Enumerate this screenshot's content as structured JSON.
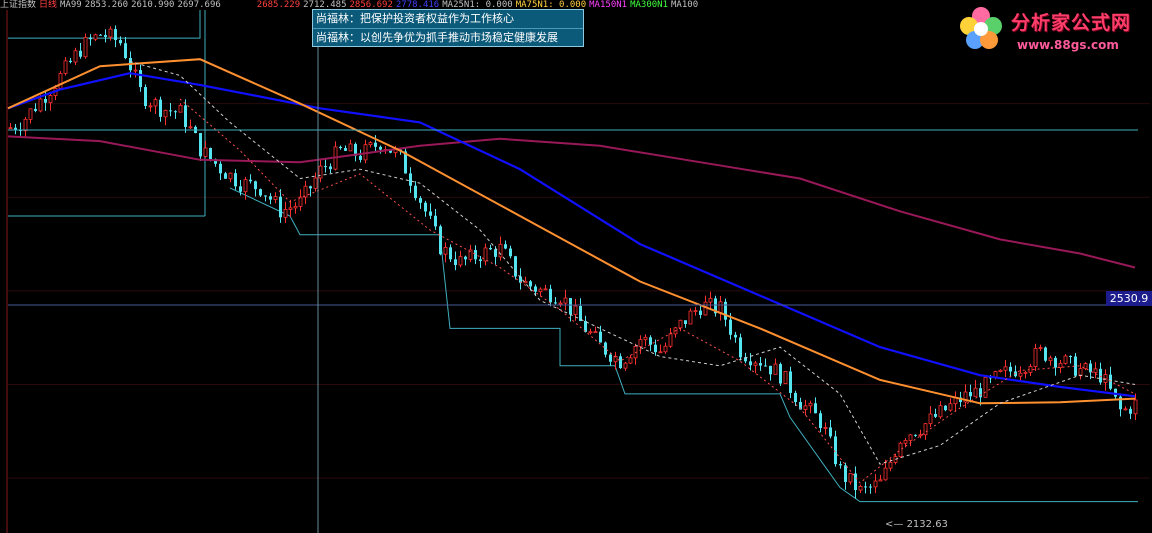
{
  "topbar": {
    "symbol": "上证指数",
    "period": "日线",
    "ma99_label": "MA99",
    "values": [
      "2853.260",
      "2610.990",
      "2697.696"
    ],
    "values2": [
      "2685.229",
      "2712.485",
      "2856.692",
      "2778.416"
    ],
    "ma25_label": "MA25N1: 0.000",
    "ma75_label": "MA75N1: 0.000",
    "ma150_label": "MA150N1",
    "ma300_label": "MA300N1",
    "ma100_label": "MA100"
  },
  "tooltip": {
    "line1": "尚福林：把保护投资者权益作为工作核心",
    "line2": "尚福林：以创先争优为抓手推动市场稳定健康发展"
  },
  "price_tag": "2530.9",
  "low_label": "2132.63",
  "logo": {
    "brand": "分析家公式网",
    "url": "www.88gs.com",
    "icon": "flower-logo-icon"
  },
  "colors": {
    "up": "#ff3030",
    "down": "#55e5f0",
    "ma_blue": "#1010ff",
    "ma_orange": "#ff9030",
    "ma_purple": "#981858",
    "ma_dashed_white": "#d0d0d0",
    "ma_dashed_red": "#ff5050",
    "cyan_line": "#40b0c0"
  },
  "chart_data": {
    "type": "candlestick",
    "price_level_line": 2530.9,
    "low_marker": 2132.63,
    "ylim": [
      2100,
      3200
    ],
    "close_path": [
      [
        0,
        2940
      ],
      [
        20,
        2960
      ],
      [
        40,
        3010
      ],
      [
        60,
        3060
      ],
      [
        80,
        3120
      ],
      [
        100,
        3150
      ],
      [
        120,
        3130
      ],
      [
        140,
        3020
      ],
      [
        160,
        2990
      ],
      [
        180,
        2980
      ],
      [
        200,
        2900
      ],
      [
        220,
        2860
      ],
      [
        240,
        2830
      ],
      [
        260,
        2820
      ],
      [
        280,
        2770
      ],
      [
        300,
        2790
      ],
      [
        320,
        2860
      ],
      [
        340,
        2900
      ],
      [
        360,
        2890
      ],
      [
        380,
        2920
      ],
      [
        400,
        2880
      ],
      [
        420,
        2790
      ],
      [
        440,
        2690
      ],
      [
        460,
        2660
      ],
      [
        480,
        2680
      ],
      [
        500,
        2690
      ],
      [
        520,
        2620
      ],
      [
        540,
        2600
      ],
      [
        560,
        2590
      ],
      [
        580,
        2530
      ],
      [
        600,
        2480
      ],
      [
        620,
        2450
      ],
      [
        640,
        2500
      ],
      [
        660,
        2470
      ],
      [
        680,
        2530
      ],
      [
        700,
        2570
      ],
      [
        720,
        2560
      ],
      [
        740,
        2470
      ],
      [
        760,
        2450
      ],
      [
        780,
        2420
      ],
      [
        800,
        2360
      ],
      [
        820,
        2320
      ],
      [
        840,
        2210
      ],
      [
        860,
        2170
      ],
      [
        880,
        2190
      ],
      [
        900,
        2290
      ],
      [
        920,
        2310
      ],
      [
        940,
        2340
      ],
      [
        960,
        2370
      ],
      [
        980,
        2390
      ],
      [
        1000,
        2420
      ],
      [
        1020,
        2440
      ],
      [
        1040,
        2470
      ],
      [
        1060,
        2450
      ],
      [
        1080,
        2430
      ],
      [
        1100,
        2420
      ],
      [
        1120,
        2340
      ],
      [
        1135,
        2360
      ]
    ],
    "ma_blue": [
      [
        8,
        2990
      ],
      [
        60,
        3030
      ],
      [
        130,
        3065
      ],
      [
        200,
        3040
      ],
      [
        320,
        2990
      ],
      [
        420,
        2960
      ],
      [
        520,
        2860
      ],
      [
        640,
        2700
      ],
      [
        760,
        2590
      ],
      [
        880,
        2480
      ],
      [
        980,
        2420
      ],
      [
        1060,
        2395
      ],
      [
        1135,
        2375
      ]
    ],
    "ma_orange": [
      [
        8,
        2990
      ],
      [
        100,
        3080
      ],
      [
        200,
        3095
      ],
      [
        300,
        3000
      ],
      [
        400,
        2900
      ],
      [
        520,
        2760
      ],
      [
        640,
        2620
      ],
      [
        760,
        2520
      ],
      [
        880,
        2410
      ],
      [
        980,
        2360
      ],
      [
        1060,
        2362
      ],
      [
        1135,
        2370
      ]
    ],
    "ma_purple": [
      [
        8,
        2930
      ],
      [
        100,
        2920
      ],
      [
        200,
        2880
      ],
      [
        300,
        2875
      ],
      [
        420,
        2910
      ],
      [
        500,
        2925
      ],
      [
        600,
        2910
      ],
      [
        700,
        2875
      ],
      [
        800,
        2840
      ],
      [
        900,
        2770
      ],
      [
        1000,
        2710
      ],
      [
        1080,
        2680
      ],
      [
        1135,
        2650
      ]
    ],
    "ma_dashed_white": [
      [
        130,
        3090
      ],
      [
        180,
        3060
      ],
      [
        230,
        2960
      ],
      [
        300,
        2840
      ],
      [
        360,
        2860
      ],
      [
        420,
        2830
      ],
      [
        480,
        2730
      ],
      [
        540,
        2580
      ],
      [
        600,
        2520
      ],
      [
        660,
        2460
      ],
      [
        720,
        2440
      ],
      [
        780,
        2480
      ],
      [
        840,
        2380
      ],
      [
        880,
        2230
      ],
      [
        940,
        2270
      ],
      [
        1000,
        2360
      ],
      [
        1080,
        2420
      ],
      [
        1135,
        2400
      ]
    ],
    "ma_dashed_red": [
      [
        180,
        3010
      ],
      [
        240,
        2900
      ],
      [
        290,
        2790
      ],
      [
        360,
        2850
      ],
      [
        430,
        2730
      ],
      [
        500,
        2650
      ],
      [
        560,
        2560
      ],
      [
        620,
        2450
      ],
      [
        680,
        2520
      ],
      [
        740,
        2450
      ],
      [
        800,
        2350
      ],
      [
        860,
        2190
      ],
      [
        900,
        2260
      ],
      [
        960,
        2350
      ],
      [
        1020,
        2430
      ],
      [
        1080,
        2440
      ],
      [
        1135,
        2380
      ]
    ],
    "cyan_steps": [
      [
        [
          8,
          3140
        ],
        [
          200,
          3140
        ],
        [
          200,
          3200
        ]
      ],
      [
        [
          205,
          3200
        ],
        [
          205,
          2760
        ]
      ],
      [
        [
          8,
          2760
        ],
        [
          205,
          2760
        ]
      ],
      [
        [
          230,
          2820
        ],
        [
          290,
          2760
        ],
        [
          300,
          2720
        ],
        [
          440,
          2720
        ],
        [
          450,
          2520
        ],
        [
          560,
          2520
        ],
        [
          560,
          2440
        ],
        [
          615,
          2440
        ],
        [
          625,
          2380
        ],
        [
          780,
          2380
        ],
        [
          790,
          2330
        ],
        [
          840,
          2180
        ],
        [
          860,
          2150
        ],
        [
          1138,
          2150
        ]
      ]
    ]
  }
}
